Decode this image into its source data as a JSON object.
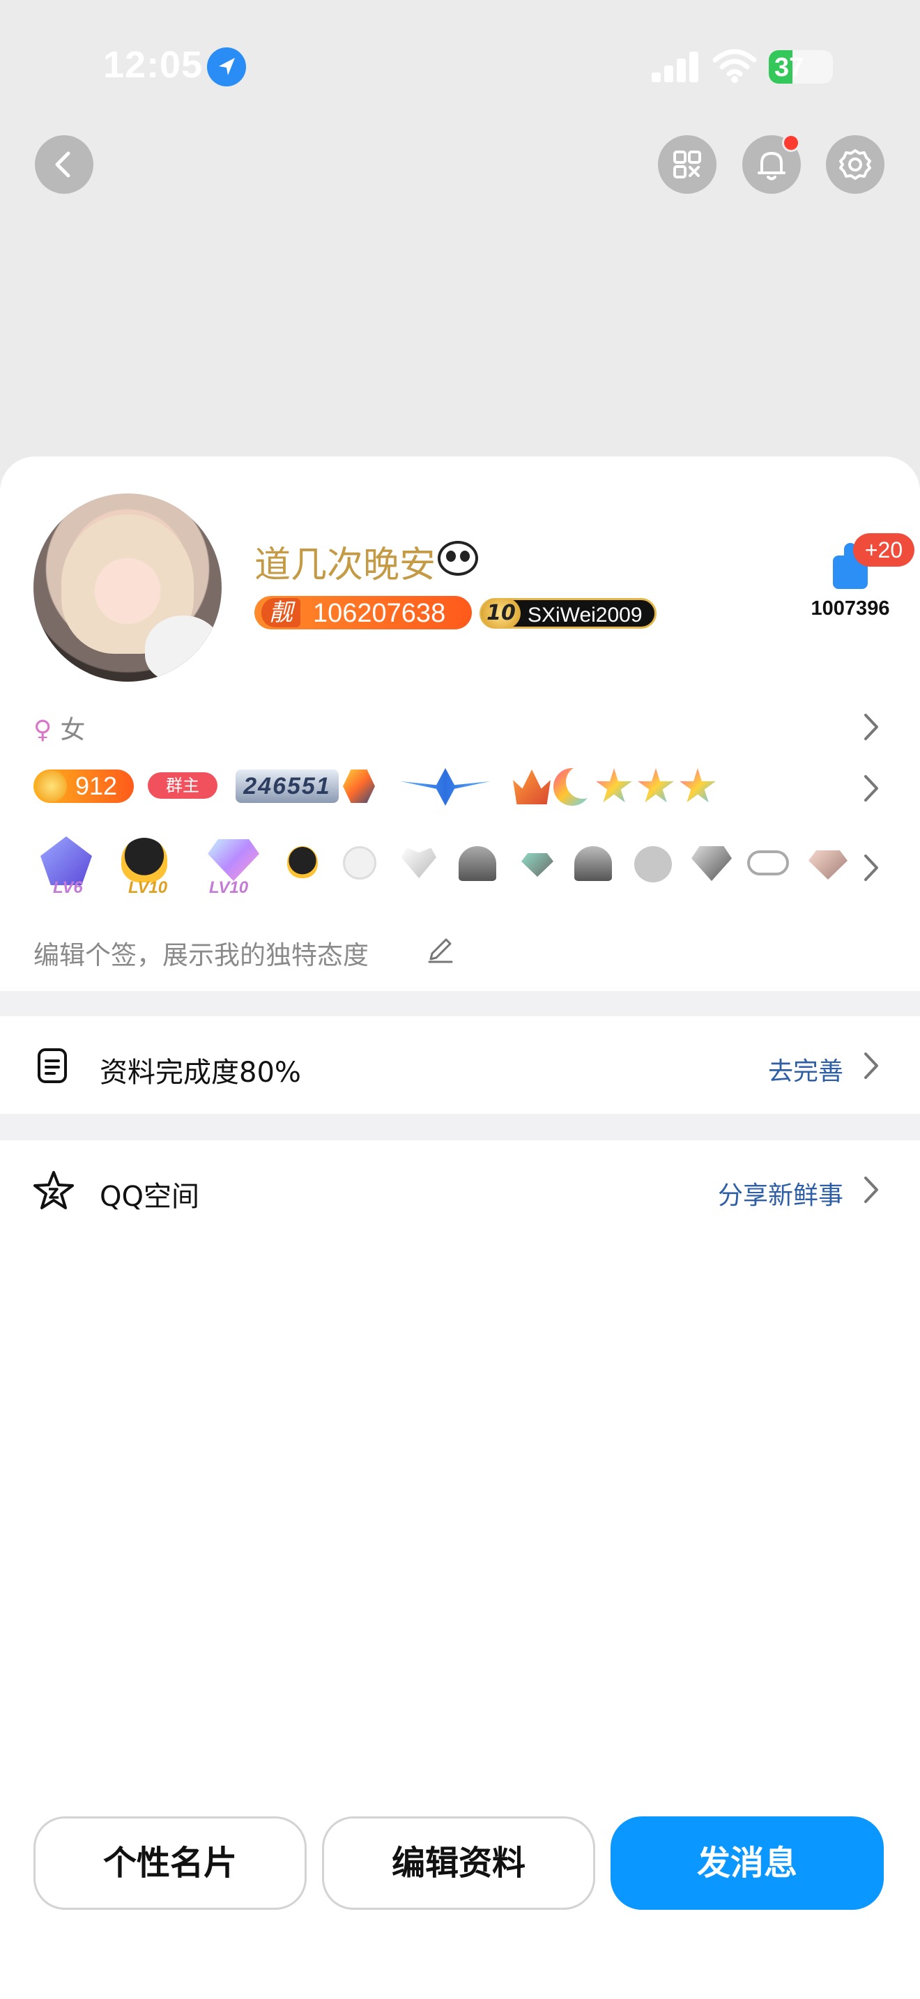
{
  "status_bar": {
    "time": "12:05",
    "battery": "37"
  },
  "profile": {
    "nickname": "道几次晚安",
    "qq_badge_tag": "靓",
    "qq_number": "106207638",
    "vip_level": "10",
    "vip_name": "SXiWei2009",
    "likes_delta": "+20",
    "likes_count": "1007396",
    "gender_symbol": "♀",
    "gender": "女"
  },
  "badges": {
    "coin_value": "912",
    "group_owner_label": "群主",
    "grade_number": "246551"
  },
  "icon_row": {
    "level_1": "LV6",
    "level_2": "LV10",
    "level_3": "LV10"
  },
  "signature": {
    "placeholder": "编辑个签，展示我的独特态度"
  },
  "list": {
    "profile_completion": {
      "label": "资料完成度80%",
      "action": "去完善"
    },
    "qzone": {
      "label": "QQ空间",
      "action": "分享新鲜事"
    }
  },
  "bottom_buttons": {
    "card": "个性名片",
    "edit": "编辑资料",
    "message": "发消息"
  },
  "colors": {
    "accent": "#0a97ff",
    "nickname": "#c49a44",
    "link": "#2e5fa6"
  }
}
